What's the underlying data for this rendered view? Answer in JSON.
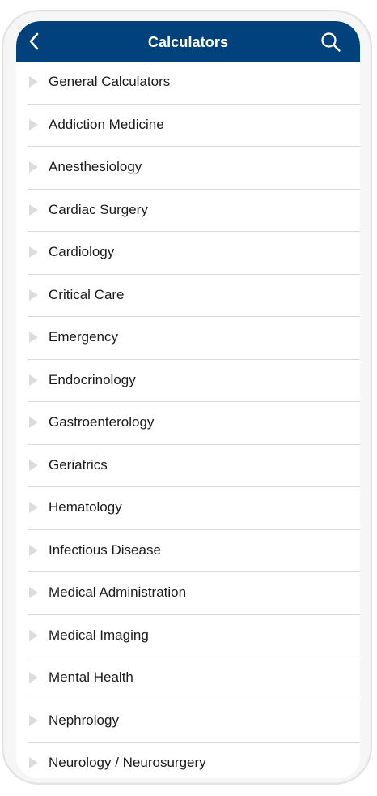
{
  "header": {
    "title": "Calculators",
    "back_icon": "chevron-left-icon",
    "search_icon": "search-icon",
    "background_color": "#02427c"
  },
  "categories": [
    {
      "label": "General Calculators"
    },
    {
      "label": "Addiction Medicine"
    },
    {
      "label": "Anesthesiology"
    },
    {
      "label": "Cardiac Surgery"
    },
    {
      "label": "Cardiology"
    },
    {
      "label": "Critical Care"
    },
    {
      "label": "Emergency"
    },
    {
      "label": "Endocrinology"
    },
    {
      "label": "Gastroenterology"
    },
    {
      "label": "Geriatrics"
    },
    {
      "label": "Hematology"
    },
    {
      "label": "Infectious Disease"
    },
    {
      "label": "Medical Administration"
    },
    {
      "label": "Medical Imaging"
    },
    {
      "label": "Mental Health"
    },
    {
      "label": "Nephrology"
    },
    {
      "label": "Neurology / Neurosurgery"
    }
  ]
}
